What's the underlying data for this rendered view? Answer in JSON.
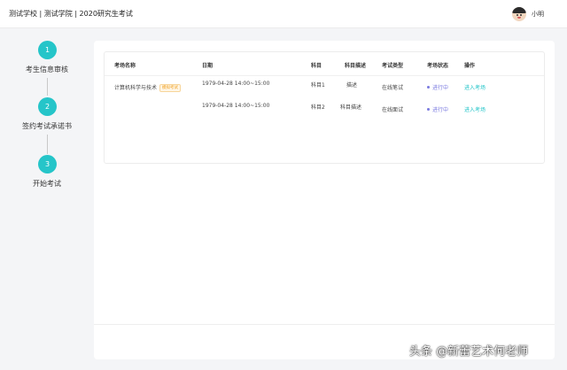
{
  "header": {
    "title": "测试学校 | 测试学院 | 2020研究生考试",
    "user_name": "小明"
  },
  "steps": [
    {
      "number": "1",
      "label": "考生信息审核"
    },
    {
      "number": "2",
      "label": "签约考试承诺书"
    },
    {
      "number": "3",
      "label": "开始考试"
    }
  ],
  "table": {
    "columns": [
      "考场名称",
      "日期",
      "科目",
      "科目描述",
      "考试类型",
      "考场状态",
      "操作"
    ],
    "exam_name": "计算机科学与技术",
    "exam_tag": "模拟考试",
    "rows": [
      {
        "date": "1979-04-28 14:00~15:00",
        "subject": "科目1",
        "desc": "描述",
        "type": "在线笔试",
        "status": "进行中",
        "action": "进入考场"
      },
      {
        "date": "1979-04-28 14:00~15:00",
        "subject": "科目2",
        "desc": "科目描述",
        "type": "在线面试",
        "status": "进行中",
        "action": "进入考场"
      }
    ]
  },
  "watermark": "头条 @新蕾艺术何老师",
  "colors": {
    "accent": "#25c5c9",
    "status": "#7b7be0",
    "tag": "#f0a020"
  }
}
